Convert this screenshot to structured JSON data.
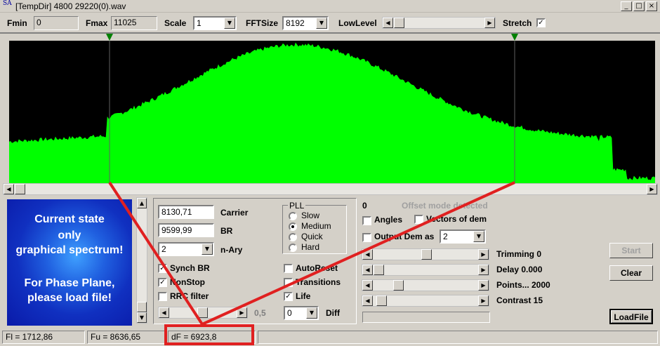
{
  "window": {
    "icon_text": "SA",
    "title": "[TempDir] 4800 29220(0).wav",
    "btn_min": "_",
    "btn_max": "□",
    "btn_close": "×"
  },
  "toolbar": {
    "fmin_label": "Fmin",
    "fmin_value": "0",
    "fmax_label": "Fmax",
    "fmax_value": "11025",
    "scale_label": "Scale",
    "scale_value": "1",
    "fftsize_label": "FFTSize",
    "fftsize_value": "8192",
    "lowlevel_label": "LowLevel",
    "stretch_label": "Stretch",
    "stretch_checked": "✓"
  },
  "spectrum": {
    "fill_color": "#00ff00",
    "background": "#000000",
    "left_marker_fraction": 0.164,
    "right_marker_fraction": 0.784
  },
  "info": {
    "line1": "Current state",
    "line2": "only",
    "line3": "graphical spectrum!",
    "line4": "For Phase Plane,",
    "line5": "please load file!"
  },
  "params": {
    "carrier_value": "8130,71",
    "carrier_label": "Carrier",
    "br_value": "9599,99",
    "br_label": "BR",
    "nary_value": "2",
    "nary_label": "n-Ary",
    "synch_br_label": "Synch BR",
    "nonstop_label": "NonStop",
    "rrc_label": "RRC filter",
    "rrc_value": "0,5",
    "autoreset_label": "AutoReset",
    "transitions_label": "Transitions",
    "life_label": "Life",
    "diff_value": "0",
    "diff_label": "Diff",
    "check_mark": "✓"
  },
  "pll": {
    "title": "PLL",
    "options": [
      "Slow",
      "Medium",
      "Quick",
      "Hard"
    ],
    "selected": "Medium"
  },
  "right": {
    "zero_label": "0",
    "offset_label": "Offset mode detected",
    "angles_label": "Angles",
    "vectors_label": "Vectors of dem",
    "output_label": "Output Dem as",
    "output_value": "2",
    "trimming_label": "Trimming 0",
    "delay_label": "Delay  0.000",
    "points_label": "Points... 2000",
    "contrast_label": "Contrast 15"
  },
  "buttons": {
    "start": "Start",
    "clear": "Clear",
    "loadfile": "LoadFile"
  },
  "status": {
    "fl": "Fl = 1712,86",
    "fu": "Fu = 8636,65",
    "df": "dF = 6923,8"
  },
  "annotation_color": "#e02020"
}
